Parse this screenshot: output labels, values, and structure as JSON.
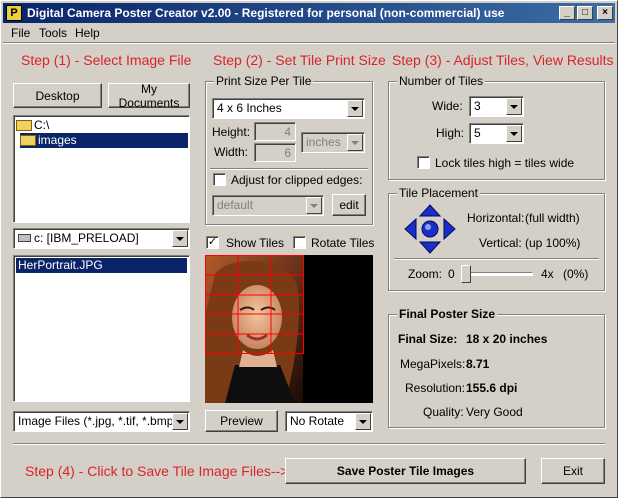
{
  "window": {
    "title": "Digital Camera Poster Creator v2.00 - Registered for personal (non-commercial) use",
    "icon_letter": "P",
    "min_glyph": "_",
    "max_glyph": "□",
    "close_glyph": "×"
  },
  "menu": {
    "file": "File",
    "tools": "Tools",
    "help": "Help"
  },
  "steps": {
    "step1": "Step (1) - Select Image File",
    "step2": "Step (2) - Set Tile Print Size",
    "step3": "Step (3) - Adjust Tiles, View Results",
    "step4": "Step (4) - Click to Save Tile Image Files-->"
  },
  "step1": {
    "desktop_button": "Desktop",
    "my_documents_button": "My Documents",
    "folders": [
      "C:\\",
      "images"
    ],
    "drive": "c: [IBM_PRELOAD]",
    "files": [
      "HerPortrait.JPG"
    ],
    "filter": "Image Files (*.jpg, *.tif, *.bmp)"
  },
  "step2": {
    "group_title": "Print Size Per Tile",
    "size": "4 x 6 Inches",
    "height_label": "Height:",
    "height_value": "4",
    "width_label": "Width:",
    "width_value": "6",
    "units": "inches",
    "adjust_label": "Adjust for clipped edges:",
    "adjust_preset": "default",
    "edit_button": "edit",
    "show_tiles_label": "Show Tiles",
    "show_tiles_checked": true,
    "rotate_tiles_label": "Rotate Tiles",
    "preview_button": "Preview",
    "rotate_option": "No Rotate"
  },
  "step3": {
    "tiles_group": "Number of Tiles",
    "wide_label": "Wide:",
    "wide_value": "3",
    "high_label": "High:",
    "high_value": "5",
    "lock_label": "Lock tiles high = tiles wide",
    "placement_group": "Tile Placement",
    "horizontal_label": "Horizontal:",
    "horizontal_value": "(full width)",
    "vertical_label": "Vertical:",
    "vertical_value": "(up 100%)",
    "zoom_label": "Zoom:",
    "zoom_min": "0",
    "zoom_max": "4x",
    "zoom_value": "(0%)",
    "zoom_level": 0.0
  },
  "final": {
    "group_title": "Final Poster Size",
    "final_size_label": "Final Size:",
    "final_size_value": "18 x 20 inches",
    "megapixels_label": "MegaPixels:",
    "megapixels_value": "8.71",
    "resolution_label": "Resolution:",
    "resolution_value": "155.6 dpi",
    "quality_label": "Quality:",
    "quality_value": "Very Good"
  },
  "actions": {
    "save_button": "Save Poster Tile Images",
    "exit_button": "Exit"
  },
  "colors": {
    "step_red": "#d9242b",
    "selection": "#0a246a",
    "grid_red": "#ff0000",
    "dpad_blue": "#1c2fc4"
  }
}
